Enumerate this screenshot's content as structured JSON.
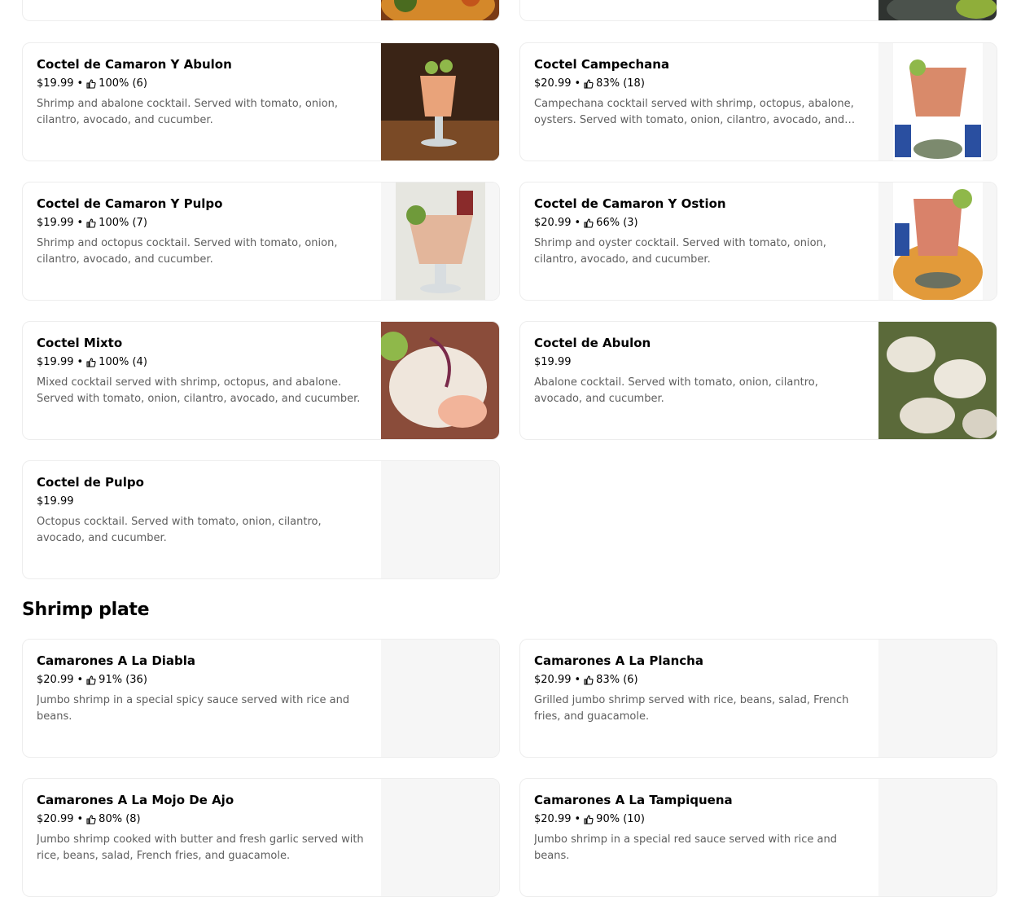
{
  "sections": {
    "cocteles_partial": [
      {
        "name": "Coctel de Camaron Y Abulon",
        "price": "$19.99",
        "rating": "100% (6)",
        "description": "Shrimp and abalone cocktail. Served with tomato, onion, cilantro, avocado, and cucumber."
      },
      {
        "name": "Coctel Campechana",
        "price": "$20.99",
        "rating": "83% (18)",
        "description": "Campechana cocktail served with shrimp, octopus, abalone, oysters. Served with tomato, onion, cilantro, avocado, and cucumber."
      },
      {
        "name": "Coctel de Camaron Y Pulpo",
        "price": "$19.99",
        "rating": "100% (7)",
        "description": "Shrimp and octopus cocktail. Served with tomato, onion, cilantro, avocado, and cucumber."
      },
      {
        "name": "Coctel de Camaron Y Ostion",
        "price": "$20.99",
        "rating": "66% (3)",
        "description": "Shrimp and oyster cocktail. Served with tomato, onion, cilantro, avocado, and cucumber."
      },
      {
        "name": "Coctel Mixto",
        "price": "$19.99",
        "rating": "100% (4)",
        "description": "Mixed cocktail served with shrimp, octopus, and abalone. Served with tomato, onion, cilantro, avocado, and cucumber."
      },
      {
        "name": "Coctel de Abulon",
        "price": "$19.99",
        "rating": "",
        "description": "Abalone cocktail. Served with tomato, onion, cilantro, avocado, and cucumber."
      },
      {
        "name": "Coctel de Pulpo",
        "price": "$19.99",
        "rating": "",
        "description": "Octopus cocktail. Served with tomato, onion, cilantro, avocado, and cucumber."
      }
    ],
    "shrimp_plate": {
      "title": "Shrimp plate",
      "items": [
        {
          "name": "Camarones A La Diabla",
          "price": "$20.99",
          "rating": "91% (36)",
          "description": "Jumbo shrimp in a special spicy sauce served with rice and beans."
        },
        {
          "name": "Camarones A La Plancha",
          "price": "$20.99",
          "rating": "83% (6)",
          "description": "Grilled jumbo shrimp served with rice, beans, salad, French fries, and guacamole."
        },
        {
          "name": "Camarones A La Mojo De Ajo",
          "price": "$20.99",
          "rating": "80% (8)",
          "description": "Jumbo shrimp cooked with butter and fresh garlic served with rice, beans, salad, French fries, and guacamole."
        },
        {
          "name": "Camarones A La Tampiquena",
          "price": "$20.99",
          "rating": "90% (10)",
          "description": "Jumbo shrimp in a special red sauce served with rice and beans."
        }
      ]
    }
  },
  "separator": "•",
  "icons": {
    "rating": "thumbs-up-icon"
  }
}
